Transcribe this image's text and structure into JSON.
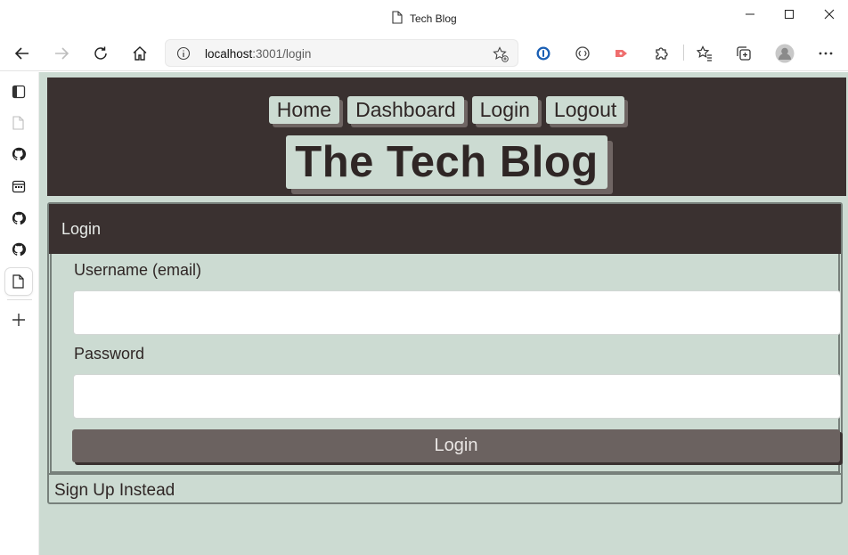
{
  "browser": {
    "tab_title": "Tech Blog",
    "address": {
      "host": "localhost",
      "rest": ":3001/login"
    }
  },
  "site": {
    "nav": [
      "Home",
      "Dashboard",
      "Login",
      "Logout"
    ],
    "brand": "The Tech Blog"
  },
  "login_card": {
    "title": "Login",
    "username_label": "Username (email)",
    "username_value": "",
    "password_label": "Password",
    "password_value": "",
    "submit_label": "Login",
    "signup_link": "Sign Up Instead"
  },
  "colors": {
    "page_background": "#ccdbd2",
    "header_background": "#3a3130",
    "button_background": "#6b6260",
    "shadow": "#6f6563"
  },
  "icons": {
    "sidebar": [
      "tab-actions-icon",
      "document-icon",
      "github-icon",
      "calendar-icon",
      "github-icon",
      "github-icon",
      "document-icon",
      "plus-icon"
    ],
    "toolbar": [
      "back-icon",
      "forward-icon",
      "refresh-icon",
      "home-icon",
      "info-icon",
      "add-favorite-icon",
      "password-manager-icon",
      "extension-icon",
      "record-icon",
      "puzzle-icon",
      "favorites-icon",
      "collections-icon",
      "profile-icon",
      "more-icon"
    ]
  }
}
